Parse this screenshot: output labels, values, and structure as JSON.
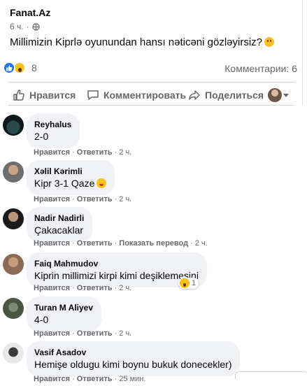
{
  "post": {
    "page_name": "Fanat.Az",
    "time": "6 ч.",
    "privacy_icon": "globe-icon",
    "text": "Millimizin Kiprlə oyunundan hansı nəticəni gözləyirsiz?",
    "text_emoji": "slightly-smiling-face"
  },
  "reactions": {
    "types": [
      "like",
      "wow"
    ],
    "count": "8",
    "comments_label": "Комментарии: 6"
  },
  "actions": {
    "like": "Нравится",
    "comment": "Комментировать",
    "share": "Поделиться"
  },
  "comments": [
    {
      "author": "Reyhalus",
      "text": "2-0",
      "like": "Нравится",
      "reply": "Ответить",
      "time": "2 ч."
    },
    {
      "author": "Xəlil Kərimli",
      "text": "Kipr 3-1 Qaze",
      "emoji": "grinning-tongue-face",
      "like": "Нравится",
      "reply": "Ответить",
      "time": "2 ч."
    },
    {
      "author": "Nadir Nadirli",
      "text": "Çakacaklar",
      "like": "Нравится",
      "reply": "Ответить",
      "translate": "Показать перевод",
      "time": "2 ч."
    },
    {
      "author": "Faiq Mahmudov",
      "text": "Kiprin millimizi kirpi kimi deşiklemesini",
      "like": "Нравится",
      "reply": "Ответить",
      "time": "2 ч.",
      "reaction": "wow",
      "reaction_count": "1"
    },
    {
      "author": "Turan M Aliyev",
      "text": "4-0",
      "like": "Нравится",
      "reply": "Ответить",
      "time": "2 ч."
    },
    {
      "author": "Vasif Asadov",
      "text": "Hemişe oldugu kimi boynu bukuk donecekler)",
      "like": "Нравится",
      "reply": "Ответить",
      "time": "25 мин."
    }
  ]
}
